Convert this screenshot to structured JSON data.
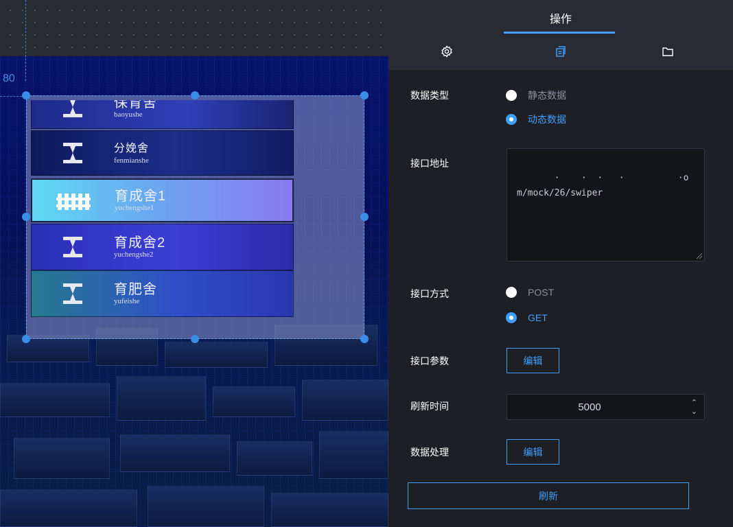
{
  "canvas": {
    "coordinate_readout": "80",
    "slides": [
      {
        "name_cn": "保育舍",
        "name_en": "baoyushe",
        "icon": "hourglass-icon",
        "active": false
      },
      {
        "name_cn": "分娩舍",
        "name_en": "fenmianshe",
        "icon": "hourglass-icon",
        "active": false
      },
      {
        "name_cn": "育成舍1",
        "name_en": "yuchengshe1",
        "icon": "fence-icon",
        "active": true
      },
      {
        "name_cn": "育成舍2",
        "name_en": "yuchengshe2",
        "icon": "hourglass-icon",
        "active": false
      },
      {
        "name_cn": "育肥舍",
        "name_en": "yufeishe",
        "icon": "hourglass-icon",
        "active": false
      }
    ]
  },
  "panel": {
    "title": "操作",
    "tabs": [
      {
        "icon": "gear-icon"
      },
      {
        "icon": "copy-icon"
      },
      {
        "icon": "folder-icon"
      }
    ],
    "data_type": {
      "label": "数据类型",
      "options": [
        {
          "label": "静态数据",
          "selected": false
        },
        {
          "label": "动态数据",
          "selected": true
        }
      ]
    },
    "api_url": {
      "label": "接口地址",
      "value": "   ·    ·  ·   ·          ·om/mock/26/swiper"
    },
    "api_method": {
      "label": "接口方式",
      "options": [
        {
          "label": "POST",
          "selected": false
        },
        {
          "label": "GET",
          "selected": true
        }
      ]
    },
    "api_params": {
      "label": "接口参数",
      "button": "编辑"
    },
    "refresh_interval": {
      "label": "刷新时间",
      "value": "5000"
    },
    "data_processing": {
      "label": "数据处理",
      "button": "编辑"
    },
    "refresh_button": "刷新"
  },
  "colors": {
    "accent": "#409eff",
    "panel_bg": "#1d1f24",
    "header_bg": "#282b33",
    "canvas_bg": "#07136b"
  }
}
